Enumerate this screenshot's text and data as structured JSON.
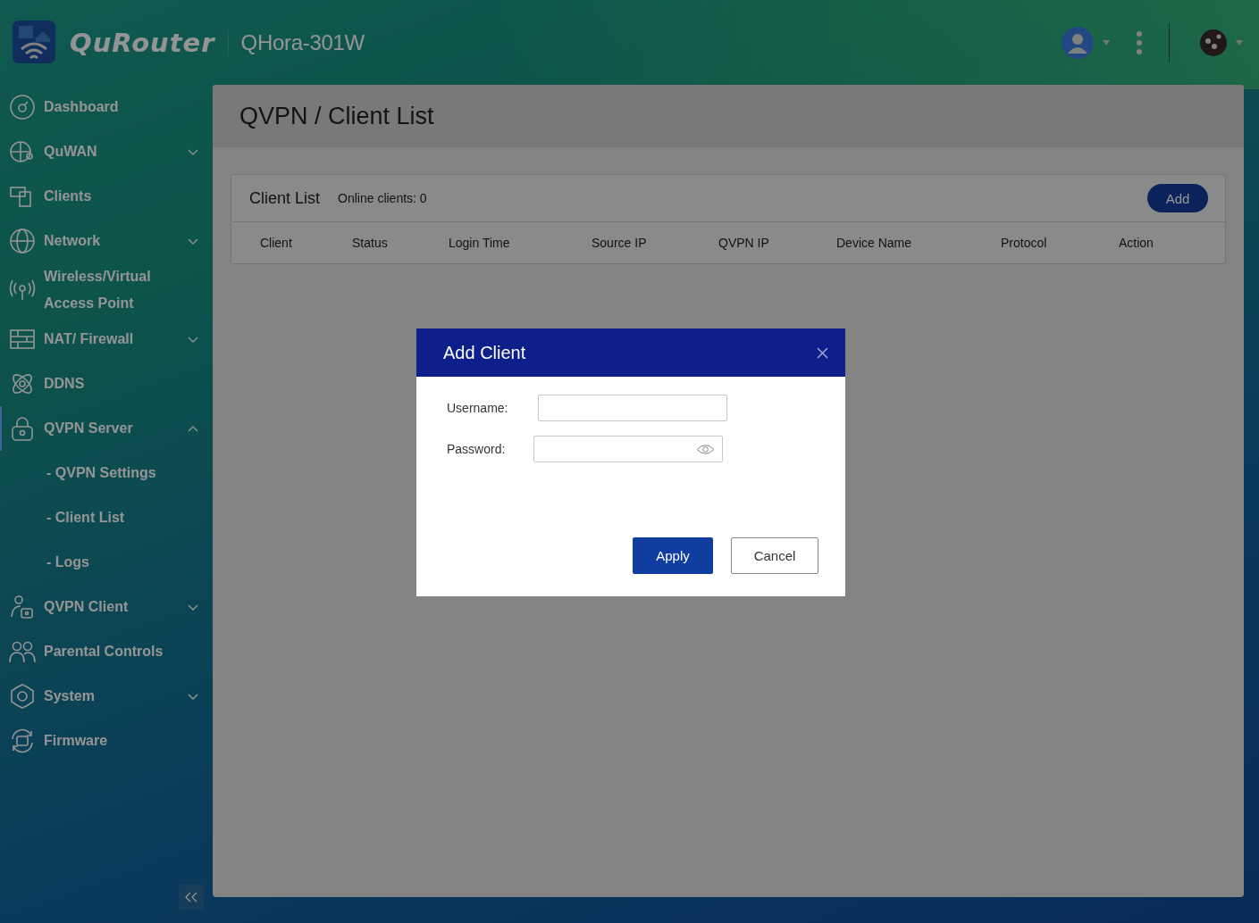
{
  "header": {
    "brand": "QuRouter",
    "device": "QHora-301W"
  },
  "sidebar": {
    "items": [
      {
        "label": "Dashboard",
        "kind": "link",
        "selected": false
      },
      {
        "label": "QuWAN",
        "kind": "group",
        "expanded": false,
        "selected": false
      },
      {
        "label": "Clients",
        "kind": "link",
        "selected": false
      },
      {
        "label": "Network",
        "kind": "group",
        "expanded": false,
        "selected": false
      },
      {
        "label": "Wireless/Virtual Access Point",
        "kind": "link",
        "selected": false
      },
      {
        "label": "NAT/ Firewall",
        "kind": "group",
        "expanded": false,
        "selected": false
      },
      {
        "label": "DDNS",
        "kind": "link",
        "selected": false
      },
      {
        "label": "QVPN Server",
        "kind": "group",
        "expanded": true,
        "selected": true,
        "children": [
          {
            "label": "- QVPN Settings"
          },
          {
            "label": "- Client List"
          },
          {
            "label": "- Logs"
          }
        ]
      },
      {
        "label": "QVPN Client",
        "kind": "group",
        "expanded": false,
        "selected": false
      },
      {
        "label": "Parental Controls",
        "kind": "link",
        "selected": false
      },
      {
        "label": "System",
        "kind": "group",
        "expanded": false,
        "selected": false
      },
      {
        "label": "Firmware",
        "kind": "link",
        "selected": false
      }
    ]
  },
  "page": {
    "title": "QVPN / Client List"
  },
  "card": {
    "title": "Client List",
    "online": "Online clients: 0",
    "add_button": "Add",
    "columns": [
      "Client",
      "Status",
      "Login Time",
      "Source IP",
      "QVPN IP",
      "Device Name",
      "Protocol",
      "Action"
    ]
  },
  "dialog": {
    "title": "Add Client",
    "fields": [
      {
        "label": "Username:",
        "kind": "text"
      },
      {
        "label": "Password:",
        "kind": "password"
      }
    ],
    "apply": "Apply",
    "cancel": "Cancel"
  }
}
